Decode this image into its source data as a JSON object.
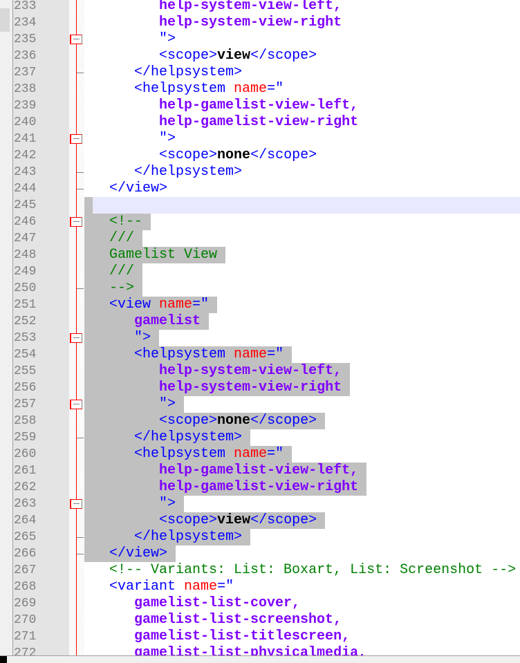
{
  "colors": {
    "tag": "#0000ff",
    "attr": "#ff0000",
    "value": "#8000ff",
    "comment": "#008000",
    "selection": "#c0c0c0",
    "current_line": "#e8e8ff"
  },
  "current_line": 245,
  "lines": [
    {
      "n": "233",
      "indent": 3,
      "tokens": [
        {
          "t": "val",
          "text": "help-system-view-left,"
        }
      ]
    },
    {
      "n": "234",
      "indent": 3,
      "tokens": [
        {
          "t": "val",
          "text": "help-system-view-right"
        }
      ]
    },
    {
      "n": "235",
      "indent": 3,
      "fold": "box",
      "tokens": [
        {
          "t": "tag",
          "text": "\">"
        }
      ]
    },
    {
      "n": "236",
      "indent": 3,
      "tokens": [
        {
          "t": "tag",
          "text": "<scope>"
        },
        {
          "t": "txt",
          "text": "view"
        },
        {
          "t": "tag",
          "text": "</scope>"
        }
      ]
    },
    {
      "n": "237",
      "indent": 2,
      "fold": "end",
      "tokens": [
        {
          "t": "tag",
          "text": "</helpsystem>"
        }
      ]
    },
    {
      "n": "238",
      "indent": 2,
      "tokens": [
        {
          "t": "tag",
          "text": "<helpsystem "
        },
        {
          "t": "attr",
          "text": "name"
        },
        {
          "t": "tag",
          "text": "=\""
        }
      ]
    },
    {
      "n": "239",
      "indent": 3,
      "tokens": [
        {
          "t": "val",
          "text": "help-gamelist-view-left,"
        }
      ]
    },
    {
      "n": "240",
      "indent": 3,
      "tokens": [
        {
          "t": "val",
          "text": "help-gamelist-view-right"
        }
      ]
    },
    {
      "n": "241",
      "indent": 3,
      "fold": "box",
      "tokens": [
        {
          "t": "tag",
          "text": "\">"
        }
      ]
    },
    {
      "n": "242",
      "indent": 3,
      "tokens": [
        {
          "t": "tag",
          "text": "<scope>"
        },
        {
          "t": "txt",
          "text": "none"
        },
        {
          "t": "tag",
          "text": "</scope>"
        }
      ]
    },
    {
      "n": "243",
      "indent": 2,
      "fold": "end",
      "tokens": [
        {
          "t": "tag",
          "text": "</helpsystem>"
        }
      ]
    },
    {
      "n": "244",
      "indent": 1,
      "fold": "end",
      "tokens": [
        {
          "t": "tag",
          "text": "</view>"
        }
      ]
    },
    {
      "n": "245",
      "indent": 0,
      "current": true,
      "tokens": []
    },
    {
      "n": "246",
      "indent": 1,
      "sel": true,
      "fold": "box",
      "tokens": [
        {
          "t": "cmt",
          "text": "<!--"
        }
      ]
    },
    {
      "n": "247",
      "indent": 1,
      "sel": true,
      "tokens": [
        {
          "t": "cmt",
          "text": "///"
        }
      ]
    },
    {
      "n": "248",
      "indent": 1,
      "sel": true,
      "tokens": [
        {
          "t": "cmt",
          "text": "Gamelist View"
        }
      ]
    },
    {
      "n": "249",
      "indent": 1,
      "sel": true,
      "tokens": [
        {
          "t": "cmt",
          "text": "///"
        }
      ]
    },
    {
      "n": "250",
      "indent": 1,
      "sel": true,
      "fold": "end",
      "tokens": [
        {
          "t": "cmt",
          "text": "-->"
        }
      ]
    },
    {
      "n": "251",
      "indent": 1,
      "sel": true,
      "tokens": [
        {
          "t": "tag",
          "text": "<view "
        },
        {
          "t": "attr",
          "text": "name"
        },
        {
          "t": "tag",
          "text": "=\""
        }
      ]
    },
    {
      "n": "252",
      "indent": 2,
      "sel": true,
      "tokens": [
        {
          "t": "val",
          "text": "gamelist"
        }
      ]
    },
    {
      "n": "253",
      "indent": 2,
      "sel": true,
      "fold": "box",
      "tokens": [
        {
          "t": "tag",
          "text": "\">"
        }
      ]
    },
    {
      "n": "254",
      "indent": 2,
      "sel": true,
      "tokens": [
        {
          "t": "tag",
          "text": "<helpsystem "
        },
        {
          "t": "attr",
          "text": "name"
        },
        {
          "t": "tag",
          "text": "=\""
        }
      ]
    },
    {
      "n": "255",
      "indent": 3,
      "sel": true,
      "tokens": [
        {
          "t": "val",
          "text": "help-system-view-left,"
        }
      ]
    },
    {
      "n": "256",
      "indent": 3,
      "sel": true,
      "tokens": [
        {
          "t": "val",
          "text": "help-system-view-right"
        }
      ]
    },
    {
      "n": "257",
      "indent": 3,
      "sel": true,
      "fold": "box",
      "tokens": [
        {
          "t": "tag",
          "text": "\">"
        }
      ]
    },
    {
      "n": "258",
      "indent": 3,
      "sel": true,
      "tokens": [
        {
          "t": "tag",
          "text": "<scope>"
        },
        {
          "t": "txt",
          "text": "none"
        },
        {
          "t": "tag",
          "text": "</scope>"
        }
      ]
    },
    {
      "n": "259",
      "indent": 2,
      "sel": true,
      "fold": "end",
      "tokens": [
        {
          "t": "tag",
          "text": "</helpsystem>"
        }
      ]
    },
    {
      "n": "260",
      "indent": 2,
      "sel": true,
      "tokens": [
        {
          "t": "tag",
          "text": "<helpsystem "
        },
        {
          "t": "attr",
          "text": "name"
        },
        {
          "t": "tag",
          "text": "=\""
        }
      ]
    },
    {
      "n": "261",
      "indent": 3,
      "sel": true,
      "tokens": [
        {
          "t": "val",
          "text": "help-gamelist-view-left,"
        }
      ]
    },
    {
      "n": "262",
      "indent": 3,
      "sel": true,
      "tokens": [
        {
          "t": "val",
          "text": "help-gamelist-view-right"
        }
      ]
    },
    {
      "n": "263",
      "indent": 3,
      "sel": true,
      "fold": "box",
      "tokens": [
        {
          "t": "tag",
          "text": "\">"
        }
      ]
    },
    {
      "n": "264",
      "indent": 3,
      "sel": true,
      "tokens": [
        {
          "t": "tag",
          "text": "<scope>"
        },
        {
          "t": "txt",
          "text": "view"
        },
        {
          "t": "tag",
          "text": "</scope>"
        }
      ]
    },
    {
      "n": "265",
      "indent": 2,
      "sel": true,
      "fold": "end",
      "tokens": [
        {
          "t": "tag",
          "text": "</helpsystem>"
        }
      ]
    },
    {
      "n": "266",
      "indent": 1,
      "sel": true,
      "fold": "end",
      "tokens": [
        {
          "t": "tag",
          "text": "</view>"
        }
      ]
    },
    {
      "n": "267",
      "indent": 1,
      "tokens": [
        {
          "t": "cmt",
          "text": "<!-- Variants: List: Boxart, List: Screenshot -->"
        }
      ]
    },
    {
      "n": "268",
      "indent": 1,
      "tokens": [
        {
          "t": "tag",
          "text": "<variant "
        },
        {
          "t": "attr",
          "text": "name"
        },
        {
          "t": "tag",
          "text": "=\""
        }
      ]
    },
    {
      "n": "269",
      "indent": 2,
      "tokens": [
        {
          "t": "val",
          "text": "gamelist-list-cover,"
        }
      ]
    },
    {
      "n": "270",
      "indent": 2,
      "tokens": [
        {
          "t": "val",
          "text": "gamelist-list-screenshot,"
        }
      ]
    },
    {
      "n": "271",
      "indent": 2,
      "tokens": [
        {
          "t": "val",
          "text": "gamelist-list-titlescreen,"
        }
      ]
    },
    {
      "n": "272",
      "indent": 2,
      "tokens": [
        {
          "t": "val",
          "text": "gamelist-list-physicalmedia,"
        }
      ]
    }
  ]
}
